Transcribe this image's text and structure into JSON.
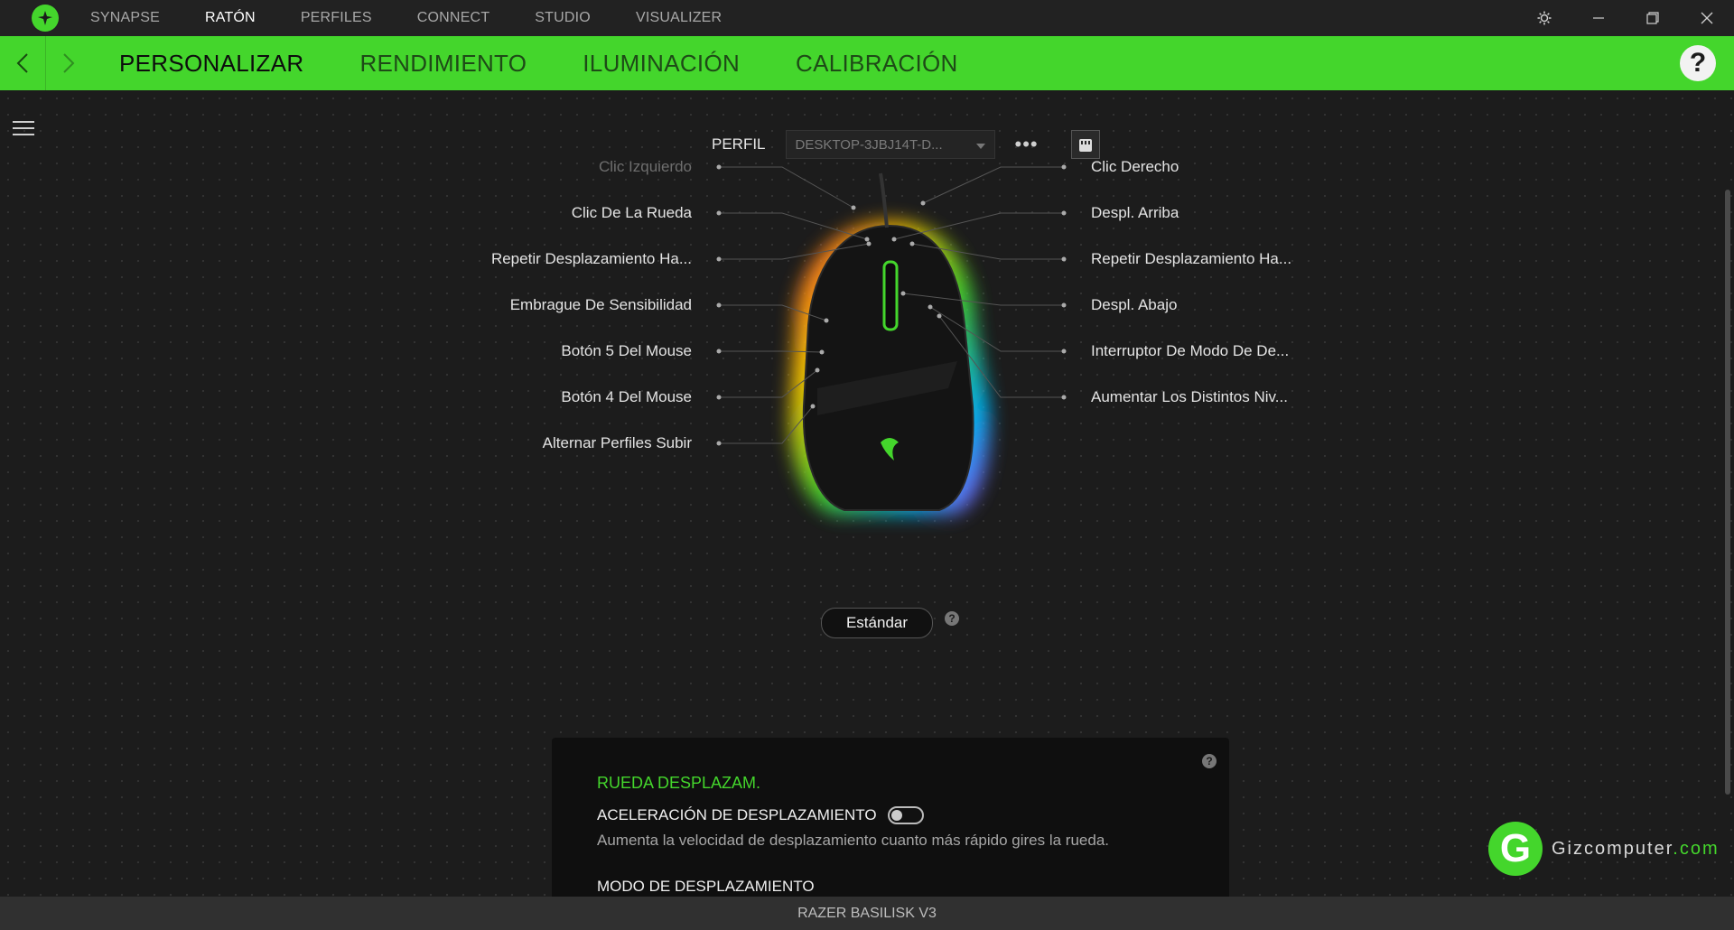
{
  "topnav": {
    "items": [
      {
        "label": "SYNAPSE"
      },
      {
        "label": "RATÓN",
        "active": true
      },
      {
        "label": "PERFILES"
      },
      {
        "label": "CONNECT"
      },
      {
        "label": "STUDIO"
      },
      {
        "label": "VISUALIZER"
      }
    ]
  },
  "subnav": {
    "tabs": [
      {
        "label": "PERSONALIZAR",
        "active": true
      },
      {
        "label": "RENDIMIENTO"
      },
      {
        "label": "ILUMINACIÓN"
      },
      {
        "label": "CALIBRACIÓN"
      }
    ],
    "help_glyph": "?"
  },
  "profile": {
    "label": "PERFIL",
    "value": "DESKTOP-3JBJ14T-D...",
    "more": "•••"
  },
  "buttons": {
    "left": [
      {
        "label": "Clic Izquierdo",
        "dim": true
      },
      {
        "label": "Clic De La Rueda"
      },
      {
        "label": "Repetir Desplazamiento Ha..."
      },
      {
        "label": "Embrague De Sensibilidad"
      },
      {
        "label": "Botón 5 Del Mouse"
      },
      {
        "label": "Botón 4 Del Mouse"
      },
      {
        "label": "Alternar Perfiles Subir"
      }
    ],
    "right": [
      {
        "label": "Clic Derecho"
      },
      {
        "label": "Despl.  Arriba"
      },
      {
        "label": "Repetir Desplazamiento Ha..."
      },
      {
        "label": "Despl. Abajo"
      },
      {
        "label": "Interruptor De Modo De De..."
      },
      {
        "label": "Aumentar Los Distintos Niv..."
      }
    ]
  },
  "preset": {
    "label": "Estándar",
    "help_glyph": "?"
  },
  "panel": {
    "title": "RUEDA  DESPLAZAM.",
    "accel_label": "ACELERACIÓN DE DESPLAZAMIENTO",
    "accel_on": false,
    "accel_desc": "Aumenta la velocidad de desplazamiento cuanto más rápido gires la rueda.",
    "mode_label": "MODO DE DESPLAZAMIENTO",
    "help_glyph": "?"
  },
  "watermark": {
    "name": "Gizcomputer",
    "domain": ".com",
    "logo_glyph": "G"
  },
  "device": {
    "name": "RAZER BASILISK V3"
  },
  "colors": {
    "accent": "#44d62c",
    "background": "#1b1b1b"
  },
  "icons": [
    "razer-logo-icon",
    "gear-icon",
    "minimize-icon",
    "restore-icon",
    "close-icon",
    "chevron-left-icon",
    "chevron-right-icon",
    "help-icon",
    "menu-icon",
    "dropdown-arrow-icon",
    "onboard-memory-icon"
  ]
}
